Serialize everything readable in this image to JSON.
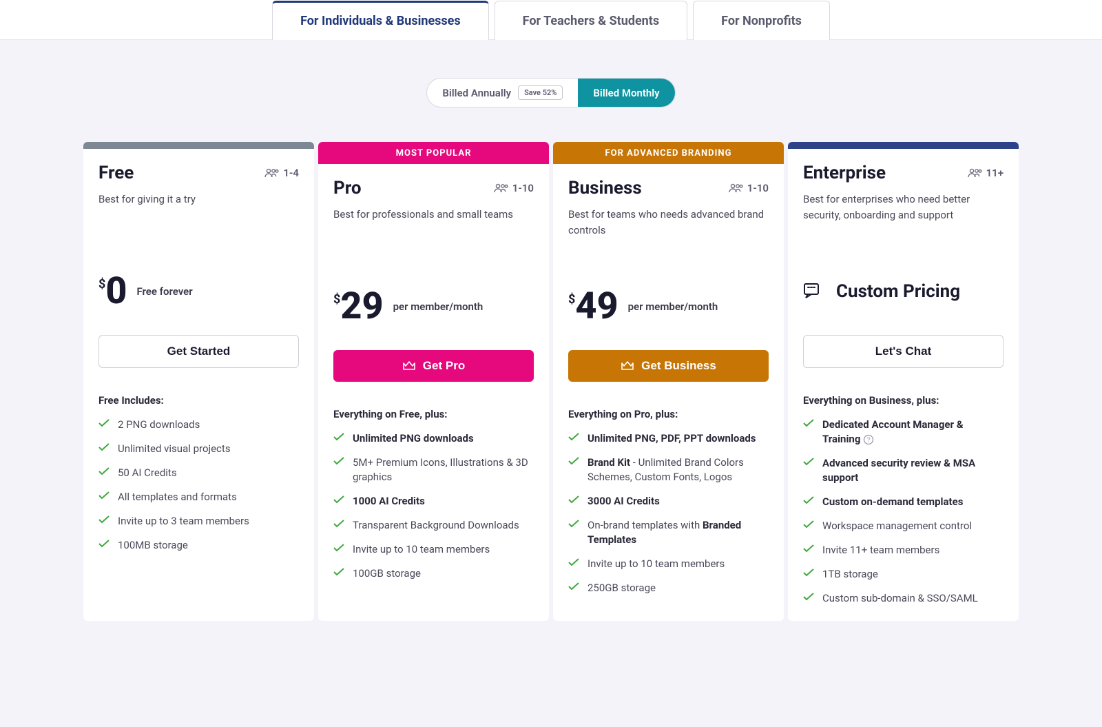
{
  "tabs": {
    "individuals": "For Individuals & Businesses",
    "teachers": "For Teachers & Students",
    "nonprofits": "For Nonprofits"
  },
  "billing": {
    "annually": "Billed Annually",
    "save_badge": "Save 52%",
    "monthly": "Billed Monthly"
  },
  "banners": {
    "most_popular": "MOST POPULAR",
    "advanced_branding": "FOR ADVANCED BRANDING"
  },
  "plans": {
    "free": {
      "name": "Free",
      "seats": "1-4",
      "desc": "Best for giving it a try",
      "currency": "$",
      "amount": "0",
      "price_note": "Free forever",
      "cta": "Get Started",
      "features_heading": "Free Includes:",
      "features": [
        "2 PNG downloads",
        "Unlimited visual projects",
        "50 AI Credits",
        "All templates and formats",
        "Invite up to 3 team members",
        "100MB storage"
      ]
    },
    "pro": {
      "name": "Pro",
      "seats": "1-10",
      "desc": "Best for professionals and small teams",
      "currency": "$",
      "amount": "29",
      "price_note": "per member/month",
      "cta": "Get Pro",
      "features_heading": "Everything on Free, plus:",
      "features": [
        "Unlimited PNG downloads",
        "5M+ Premium Icons, Illustrations & 3D graphics",
        "1000 AI Credits",
        "Transparent Background Downloads",
        "Invite up to 10 team members",
        "100GB storage"
      ]
    },
    "business": {
      "name": "Business",
      "seats": "1-10",
      "desc": "Best for teams who needs advanced brand controls",
      "currency": "$",
      "amount": "49",
      "price_note": "per member/month",
      "cta": "Get Business",
      "features_heading": "Everything on Pro, plus:",
      "feature_0": "Unlimited PNG, PDF, PPT downloads",
      "feature_1_bold": "Brand Kit",
      "feature_1_rest": " - Unlimited Brand Colors Schemes, Custom Fonts, Logos",
      "feature_2": "3000 AI Credits",
      "feature_3_pre": "On-brand templates with ",
      "feature_3_bold": "Branded Templates",
      "feature_4": "Invite up to 10 team members",
      "feature_5": "250GB storage"
    },
    "enterprise": {
      "name": "Enterprise",
      "seats": "11+",
      "desc": "Best for enterprises who need better security, onboarding and support",
      "custom_pricing": "Custom Pricing",
      "cta": "Let's Chat",
      "features_heading": "Everything on Business, plus:",
      "feature_0_bold": "Dedicated Account Manager & Training",
      "feature_1_bold": "Advanced security review & MSA support",
      "feature_2_bold": "Custom on-demand templates",
      "feature_3": "Workspace management control",
      "feature_4": "Invite 11+ team members",
      "feature_5": "1TB storage",
      "feature_6": "Custom sub-domain & SSO/SAML"
    }
  }
}
